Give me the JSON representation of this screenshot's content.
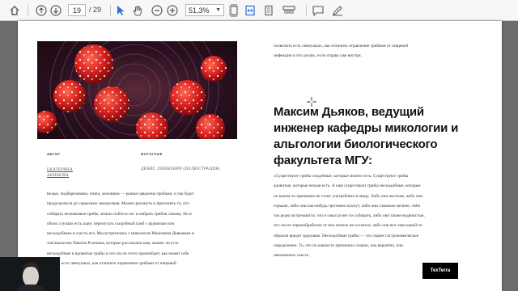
{
  "toolbar": {
    "current_page": "19",
    "total_pages": "/ 29",
    "zoom": "51,3%",
    "icons": [
      "home-icon",
      "page-up-icon",
      "page-down-icon",
      "select-arrow-icon",
      "hand-tool-icon",
      "zoom-out-icon",
      "zoom-in-icon",
      "zoom-dropdown-icon",
      "fit-page-icon",
      "fit-width-icon",
      "print-icon",
      "comment-icon",
      "pen-icon"
    ]
  },
  "article": {
    "author_label": "АВТОР",
    "author_name_line1": "ЕКАТЕРИНА",
    "author_name_line2": "АКИМОВА",
    "photo_label": "ФОТОГРАФ",
    "photo_name": "ДЕНИС ЛЯШКЕВИЧ (ИЛЛЮСТРАЦИЯ)",
    "left_paragraph": [
      "Белые, подберезовики, опята, моховики — рынки завалены грибами, и так будет",
      "продолжаться до серьезных заморозков. Можно рискнуть и притопить то, что",
      "собирать незнакомые грибы, можно пойти в лес и набрать грибов самому. Но в",
      "обоих случаях есть шанс перепутать съедобный гриб с ядовитым или",
      "несъедобным и съесть его. Мы встретились с микологом Максимом Дьяковым и",
      "токсикологом Павлом Розиным, которые рассказали нам, можно ли есть",
      "несъедобные и ядовитые грибы и что после этого произойдет, как может себе",
      "помочь есть свинушках, как отличить отравление грибами от пищевой"
    ],
    "right_top": [
      "позволить есть свинушках, как отличить отравление грибами от пищевой",
      "инфекции и что делать, если отрава уже внутри."
    ],
    "heading": "Максим Дьяков, ведущий инженер кафедры микологии и альгологии биологического факультета МГУ:",
    "right_paragraph": [
      "«Существуют грибы съедобные, которые можно есть. Существуют грибы",
      "ядовитые, которые нельзя есть. А еще существуют грибы несъедобные, которые",
      "по каким-то причинам не стоит употреблять в пищу. Либо они жесткие, либо они",
      "горькие, либо они как-нибудь противно пахнут, либо они слишком мелкие, либо",
      "так редко встречаются, что и смысла нет их собирать, либо они также водянистые,",
      "что после термообработки от них ничего не остается, либо они все-таки какой-то",
      "образом вредят здоровью. Несъедобные грибы — это скорее гастрономическое",
      "определение. То, что по каким-то причинам сложно, она вероятно, или",
      "невозможно съесть."
    ],
    "logo_text": "TexTerra"
  },
  "colors": {
    "toolbar_bg": "#f7f7f7",
    "viewer_bg": "#6d6d6d",
    "page_bg": "#ffffff",
    "active_icon": "#2c6fd6"
  }
}
